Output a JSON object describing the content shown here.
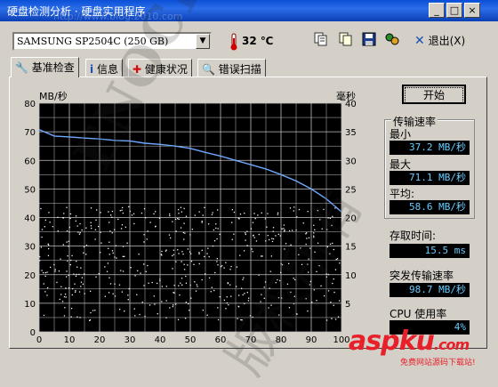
{
  "window": {
    "title": "硬盘检测分析 · 硬盘实用程序",
    "title_watermark": "http://www.blog.2010.com",
    "controls": {
      "minimize": "_",
      "maximize": "□",
      "close": "×"
    }
  },
  "toolbar": {
    "drive": "SAMSUNG SP2504C (250 GB)",
    "temperature": "32 ℃",
    "exit_label": "退出(X)",
    "icons": [
      "copy-icon",
      "copy-all-icon",
      "save-icon",
      "options-icon",
      "close-icon"
    ]
  },
  "tabs": [
    {
      "label": "基准检查",
      "icon": "wrench-icon",
      "active": true
    },
    {
      "label": "信息",
      "icon": "info-icon",
      "active": false
    },
    {
      "label": "健康状况",
      "icon": "health-cross-icon",
      "active": false
    },
    {
      "label": "错误扫描",
      "icon": "magnifier-icon",
      "active": false
    }
  ],
  "chart_data": {
    "type": "line",
    "left_axis_label": "MB/秒",
    "right_axis_label": "毫秒",
    "x_ticks": [
      0,
      10,
      20,
      30,
      40,
      50,
      60,
      70,
      80,
      90,
      100
    ],
    "y_left_ticks": [
      0,
      10,
      20,
      30,
      40,
      50,
      60,
      70,
      80
    ],
    "y_right_ticks": [
      5,
      10,
      15,
      20,
      25,
      30,
      35,
      40
    ],
    "xlim": [
      0,
      100
    ],
    "ylim_left": [
      0,
      80
    ],
    "ylim_right": [
      0,
      40
    ],
    "grid": true,
    "series": [
      {
        "color": "#6fa8ff",
        "x": [
          0,
          5,
          10,
          15,
          20,
          25,
          30,
          35,
          40,
          45,
          50,
          55,
          60,
          65,
          70,
          75,
          80,
          85,
          90,
          95,
          100
        ],
        "y": [
          70.8,
          68.5,
          68.2,
          67.8,
          67.5,
          67.0,
          66.8,
          66.0,
          65.6,
          65.0,
          64.2,
          62.8,
          61.5,
          60.0,
          58.5,
          57.0,
          55.0,
          52.8,
          50.0,
          46.5,
          42.0
        ]
      }
    ],
    "scatter_note": "access time points (white dots)",
    "access_time_range_ms": [
      2,
      22
    ]
  },
  "side_panel": {
    "start_label": "开始",
    "transfer_group_title": "传输速率",
    "min_label": "最小",
    "min_value": "37.2 MB/秒",
    "max_label": "最大",
    "max_value": "71.1 MB/秒",
    "avg_label": "平均:",
    "avg_value": "58.6 MB/秒",
    "access_label": "存取时间:",
    "access_value": "15.5 ms",
    "burst_label": "突发传输速率",
    "burst_value": "98.7 MB/秒",
    "cpu_label": "CPU 使用率",
    "cpu_value": "4%"
  },
  "watermark": {
    "text1": "ENOCH",
    "text2": "版权所有"
  },
  "branding": {
    "logo": "aspku",
    "logo_suffix": ".com",
    "sub": "免费网站源码下载站!"
  }
}
